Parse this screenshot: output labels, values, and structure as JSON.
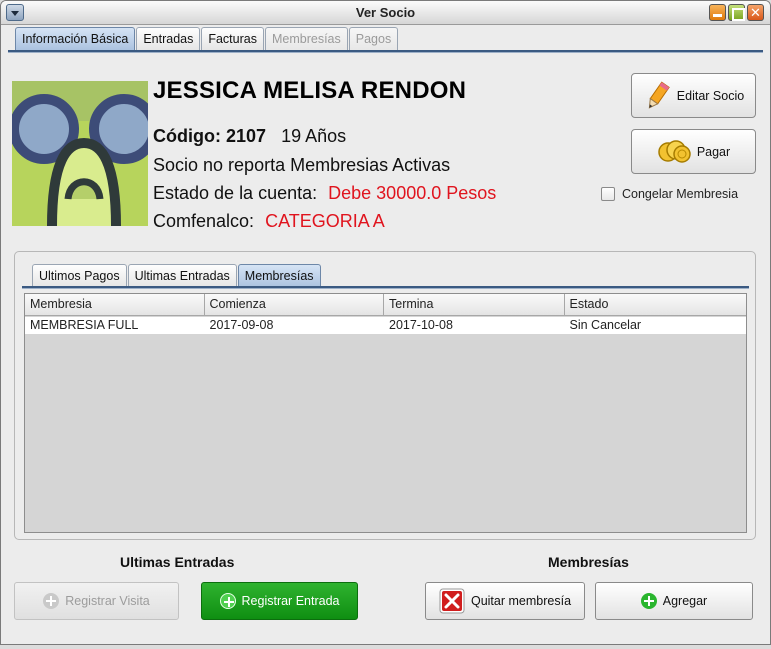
{
  "window": {
    "title": "Ver Socio"
  },
  "tabs": [
    {
      "label": "Información Básica",
      "state": "active"
    },
    {
      "label": "Entradas",
      "state": "normal"
    },
    {
      "label": "Facturas",
      "state": "normal"
    },
    {
      "label": "Membresías",
      "state": "disabled"
    },
    {
      "label": "Pagos",
      "state": "disabled"
    }
  ],
  "member": {
    "name": "JESSICA MELISA RENDON",
    "code_label": "Código:",
    "code": "2107",
    "age": "19 Años",
    "membership_status": "Socio no reporta Membresias Activas",
    "account_label": "Estado de la cuenta:",
    "account_value": "Debe 30000.0 Pesos",
    "comfenalco_label": "Comfenalco:",
    "comfenalco_value": "CATEGORIA A"
  },
  "actions": {
    "edit_label": "Editar Socio",
    "pay_label": "Pagar",
    "freeze_label": "Congelar Membresia",
    "freeze_checked": false
  },
  "inner_tabs": [
    {
      "label": "Ultimos Pagos",
      "state": "normal"
    },
    {
      "label": "Ultimas Entradas",
      "state": "normal"
    },
    {
      "label": "Membresías",
      "state": "active"
    }
  ],
  "table": {
    "columns": [
      "Membresia",
      "Comienza",
      "Termina",
      "Estado"
    ],
    "rows": [
      [
        "MEMBRESIA FULL",
        "2017-09-08",
        "2017-10-08",
        "Sin Cancelar"
      ]
    ]
  },
  "entradas": {
    "heading": "Ultimas Entradas",
    "register_visit_label": "Registrar Visita",
    "register_entry_label": "Registrar Entrada"
  },
  "membresias": {
    "heading": "Membresías",
    "remove_label": "Quitar membresía",
    "add_label": "Agregar"
  },
  "colors": {
    "accent": "#3b5a82",
    "alert": "#e0141e",
    "primary_action": "#129a14"
  },
  "icons": {
    "edit": "pencil-icon",
    "pay": "coins-icon",
    "remove": "red-x-icon",
    "add": "plus-circle-icon"
  }
}
